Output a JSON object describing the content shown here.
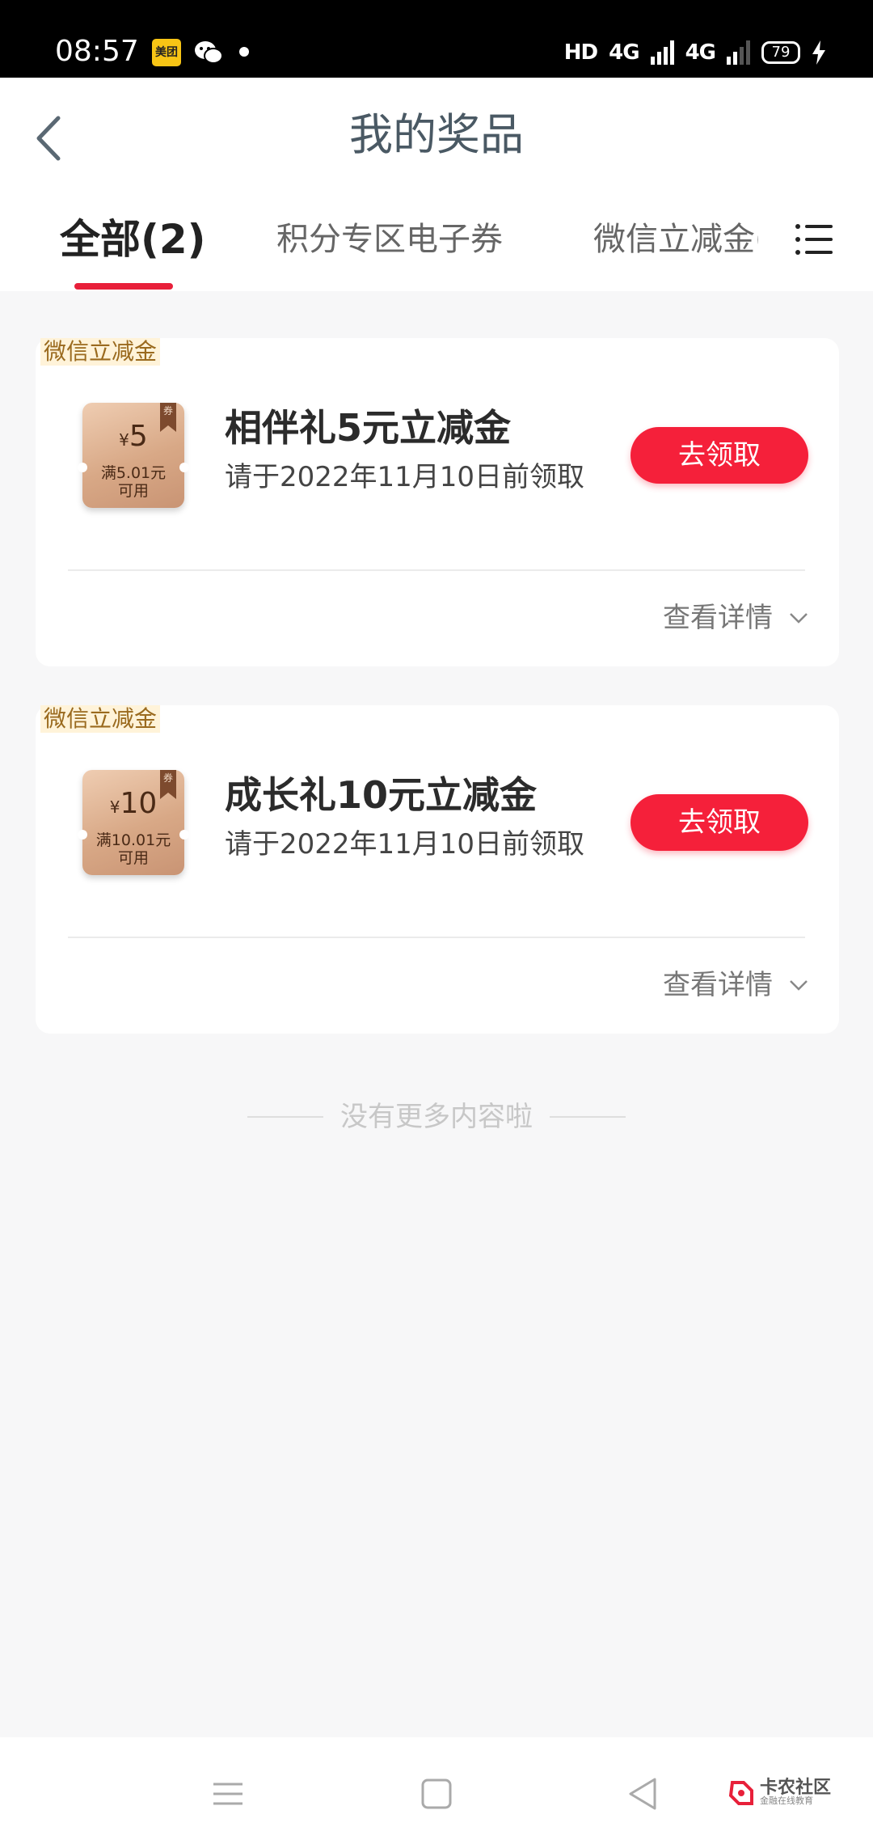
{
  "status_bar": {
    "time": "08:57",
    "meituan_label": "美团",
    "network_1": "HD",
    "network_2": "4G",
    "network_3": "4G",
    "battery": "79"
  },
  "header": {
    "title": "我的奖品",
    "tabs": [
      {
        "label": "全部(2)",
        "active": true
      },
      {
        "label": "积分专区电子券",
        "active": false
      },
      {
        "label": "微信立减金(",
        "active": false
      }
    ]
  },
  "cards": [
    {
      "tag": "微信立减金",
      "coupon_currency": "¥",
      "coupon_amount": "5",
      "coupon_condition_1": "满5.01元",
      "coupon_condition_2": "可用",
      "coupon_ribbon": "券",
      "name": "相伴礼5元立减金",
      "deadline": "请于2022年11月10日前领取",
      "claim_label": "去领取",
      "details_label": "查看详情"
    },
    {
      "tag": "微信立减金",
      "coupon_currency": "¥",
      "coupon_amount": "10",
      "coupon_condition_1": "满10.01元",
      "coupon_condition_2": "可用",
      "coupon_ribbon": "券",
      "name": "成长礼10元立减金",
      "deadline": "请于2022年11月10日前领取",
      "claim_label": "去领取",
      "details_label": "查看详情"
    }
  ],
  "footer_note": "没有更多内容啦",
  "watermark": {
    "title": "卡农社区",
    "subtitle": "金融在线教育"
  },
  "colors": {
    "accent": "#f5203a",
    "tab_underline": "#e8203a",
    "tag_text": "#9a6a1e",
    "title_text": "#4a5964"
  }
}
